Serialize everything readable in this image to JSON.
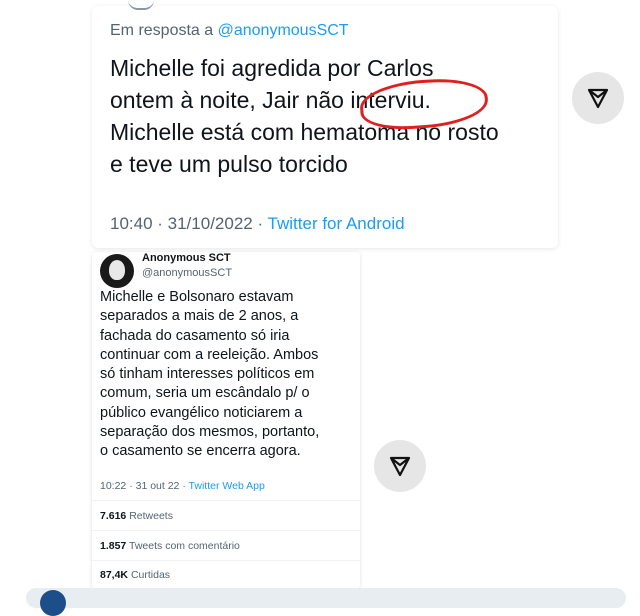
{
  "reply_tweet": {
    "reply_prefix": "Em resposta a",
    "reply_handle": "@anonymousSCT",
    "text_lines": [
      "Michelle foi agredida por Carlos",
      "ontem à noite, Jair não interviu.",
      "Michelle está com hematoma no rosto",
      "e teve um pulso torcido"
    ],
    "timestamp": "10:40 · 31/10/2022 · ",
    "source": "Twitter for Android",
    "highlighted_word": "interviu."
  },
  "original_tweet": {
    "author_name": "Anonymous SCT",
    "author_handle": "@anonymousSCT",
    "text_lines": [
      "Michelle e Bolsonaro estavam",
      "separados a mais de 2 anos, a",
      "fachada do casamento só iria",
      "continuar com a reeleição. Ambos",
      "só tinham interesses políticos em",
      "comum, seria um escândalo p/ o",
      "público evangélico noticiarem a",
      "separação dos mesmos, portanto,",
      "o casamento se encerra agora."
    ],
    "timestamp": "10:22 · 31 out 22 · ",
    "source": "Twitter Web App",
    "stats": [
      {
        "value": "7.616",
        "label": "Retweets"
      },
      {
        "value": "1.857",
        "label": "Tweets com comentário"
      },
      {
        "value": "87,4K",
        "label": "Curtidas"
      }
    ]
  },
  "icons": {
    "share": "share-send-icon",
    "avatar": "anonymous-mask-avatar"
  },
  "colors": {
    "link": "#1d9bf0",
    "secondary_text": "#536471",
    "annotation": "#e02020"
  }
}
